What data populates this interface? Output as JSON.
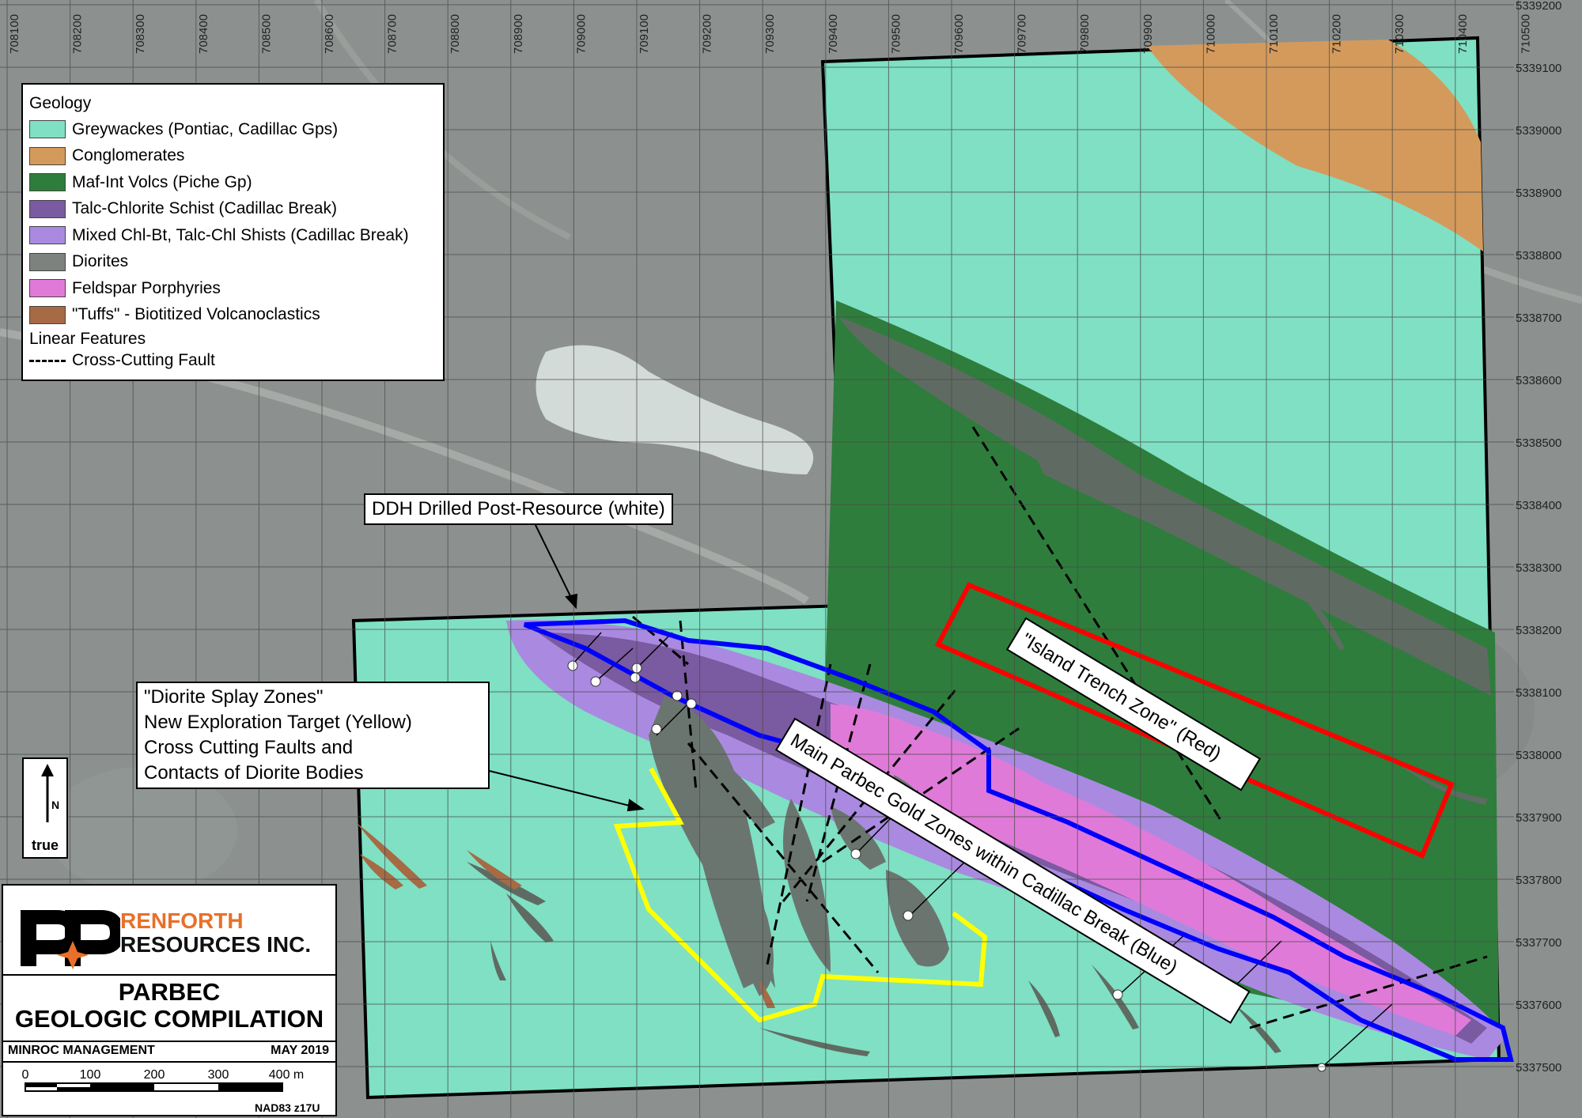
{
  "legend": {
    "title": "Geology",
    "items": [
      {
        "label": "Greywackes (Pontiac, Cadillac Gps)",
        "color": "#7fe0c3"
      },
      {
        "label": "Conglomerates",
        "color": "#d49a5c"
      },
      {
        "label": "Maf-Int Volcs (Piche Gp)",
        "color": "#2e7d3c"
      },
      {
        "label": "Talc-Chlorite Schist (Cadillac Break)",
        "color": "#7a5aa0"
      },
      {
        "label": "Mixed Chl-Bt, Talc-Chl Shists (Cadillac Break)",
        "color": "#a98ae0"
      },
      {
        "label": "Diorites",
        "color": "#7d827f"
      },
      {
        "label": "Feldspar Porphyries",
        "color": "#e07ad8"
      },
      {
        "label": "\"Tuffs\" - Biotitized Volcanoclastics",
        "color": "#a66a45"
      }
    ],
    "linear_title": "Linear Features",
    "linear_items": [
      {
        "label": "Cross-Cutting Fault"
      }
    ]
  },
  "callouts": {
    "ddh": "DDH Drilled Post-Resource (white)",
    "diorite_lines": [
      "\"Diorite Splay Zones\"",
      "New Exploration Target (Yellow)",
      "Cross Cutting Faults and",
      "Contacts of Diorite Bodies"
    ],
    "island": "\"Island Trench Zone\" (Red)",
    "main": "Main Parbec Gold Zones within Cadillac Break (Blue)"
  },
  "zone_colors": {
    "island": "#ff0000",
    "main": "#0000ff",
    "diorite": "#ffff00",
    "drillholes": "#ffffff"
  },
  "north_arrow": {
    "letter": "N",
    "label": "true"
  },
  "title_block": {
    "company_line1": "RENFORTH",
    "company_line2": "RESOURCES INC.",
    "title_line1": "PARBEC",
    "title_line2": "GEOLOGIC COMPILATION",
    "management": "MINROC MANAGEMENT",
    "date": "MAY 2019",
    "scale_labels": [
      "0",
      "100",
      "200",
      "300",
      "400 m"
    ],
    "projection": "NAD83 z17U"
  },
  "grid": {
    "eastings": [
      "708100",
      "708200",
      "708300",
      "708400",
      "708500",
      "708600",
      "708700",
      "708800",
      "708900",
      "709000",
      "709100",
      "709200",
      "709300",
      "709400",
      "709500",
      "709600",
      "709700",
      "709800",
      "709900",
      "710000",
      "710100",
      "710200",
      "710300",
      "710400",
      "710500"
    ],
    "northings": [
      "5339200",
      "5339100",
      "5339000",
      "5338900",
      "5338800",
      "5338700",
      "5338600",
      "5338500",
      "5338400",
      "5338300",
      "5338200",
      "5338100",
      "5338000",
      "5337900",
      "5337800",
      "5337700",
      "5337600",
      "5337500"
    ]
  }
}
